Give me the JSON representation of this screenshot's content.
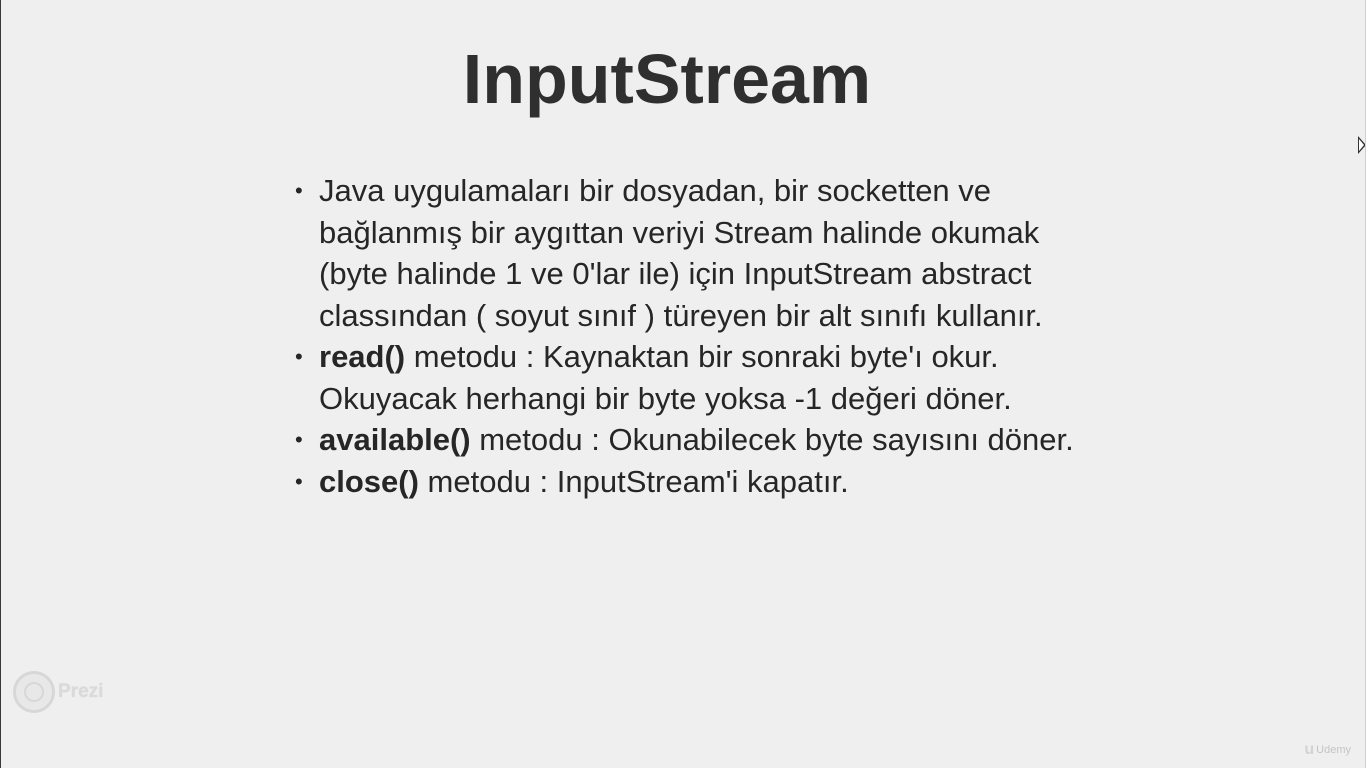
{
  "slide": {
    "title": "InputStream",
    "bullets": [
      {
        "keyword": "",
        "text": "Java uygulamaları bir dosyadan, bir socketten ve bağlanmış bir aygıttan veriyi Stream halinde okumak (byte halinde 1 ve 0'lar ile) için InputStream abstract classından ( soyut sınıf ) türeyen bir alt sınıfı kullanır."
      },
      {
        "keyword": "read()",
        "text": " metodu : Kaynaktan bir sonraki byte'ı okur. Okuyacak herhangi bir byte yoksa -1 değeri döner."
      },
      {
        "keyword": "available()",
        "text": " metodu : Okunabilecek byte sayısını döner."
      },
      {
        "keyword": "close()",
        "text": " metodu :  InputStream'i kapatır."
      }
    ],
    "bullet_symbol": "•"
  },
  "watermarks": {
    "prezi": "Prezi",
    "udemy": "Udemy"
  },
  "icons": {
    "prezi_logo": "prezi-circle-icon",
    "udemy_logo": "udemy-u-icon",
    "cursor": "mouse-cursor-icon"
  },
  "colors": {
    "background": "#efefef",
    "text": "#262626",
    "title": "#2f2f2f"
  }
}
